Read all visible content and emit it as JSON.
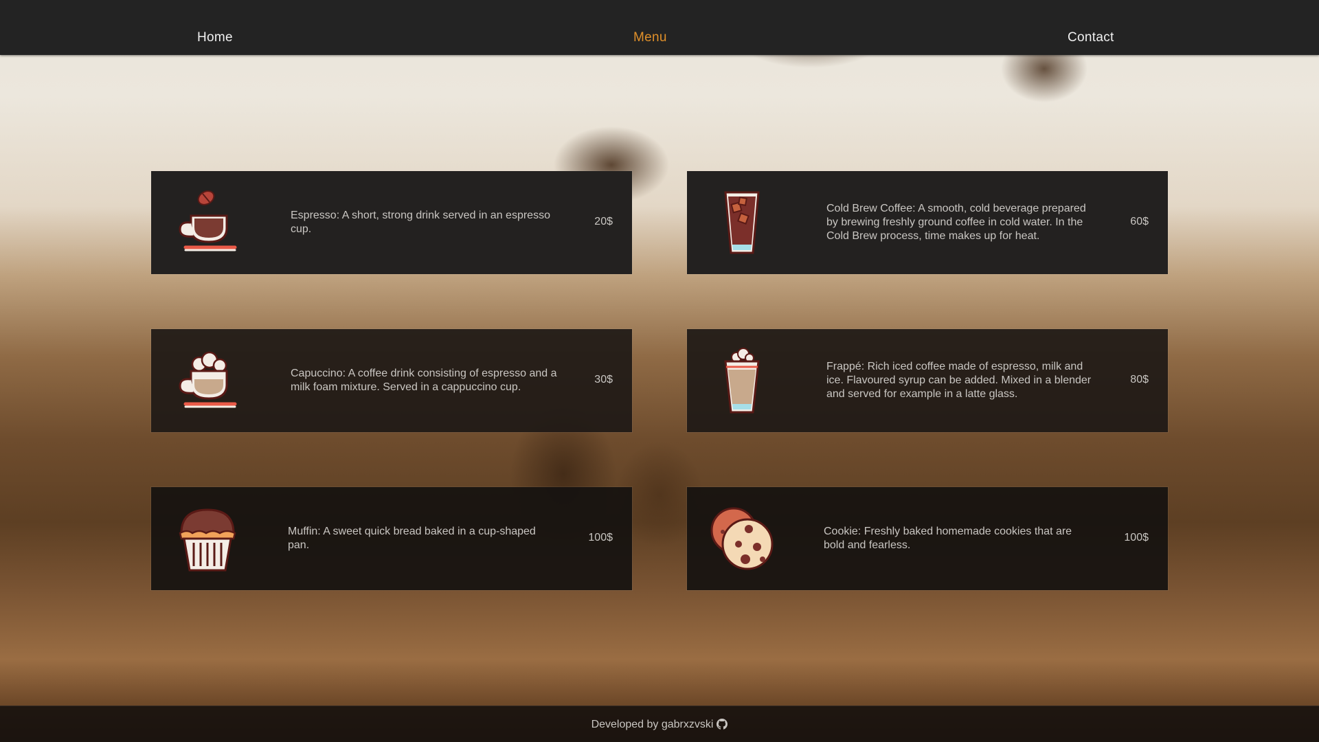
{
  "nav": {
    "home": "Home",
    "menu": "Menu",
    "contact": "Contact",
    "active_color": "#e0902a"
  },
  "menu_items": [
    {
      "icon": "espresso-cup-icon",
      "description": "Espresso: A short, strong drink served in an espresso cup.",
      "price": "20$"
    },
    {
      "icon": "cold-brew-glass-icon",
      "description": "Cold Brew Coffee: A smooth, cold beverage prepared by brewing freshly ground coffee in cold water. In the Cold Brew process, time makes up for heat.",
      "price": "60$"
    },
    {
      "icon": "cappuccino-cup-icon",
      "description": "Capuccino: A coffee drink consisting of espresso and a milk foam mixture. Served in a cappuccino cup.",
      "price": "30$"
    },
    {
      "icon": "frappe-glass-icon",
      "description": "Frappé: Rich iced coffee made of espresso, milk and ice. Flavoured syrup can be added. Mixed in a blender and served for example in a latte glass.",
      "price": "80$"
    },
    {
      "icon": "muffin-icon",
      "description": "Muffin: A sweet quick bread baked in a cup-shaped pan.",
      "price": "100$"
    },
    {
      "icon": "cookie-icon",
      "description": "Cookie: Freshly baked homemade cookies that are bold and fearless.",
      "price": "100$"
    }
  ],
  "footer": {
    "text": "Developed by gabrxzvski",
    "icon": "github-icon"
  }
}
